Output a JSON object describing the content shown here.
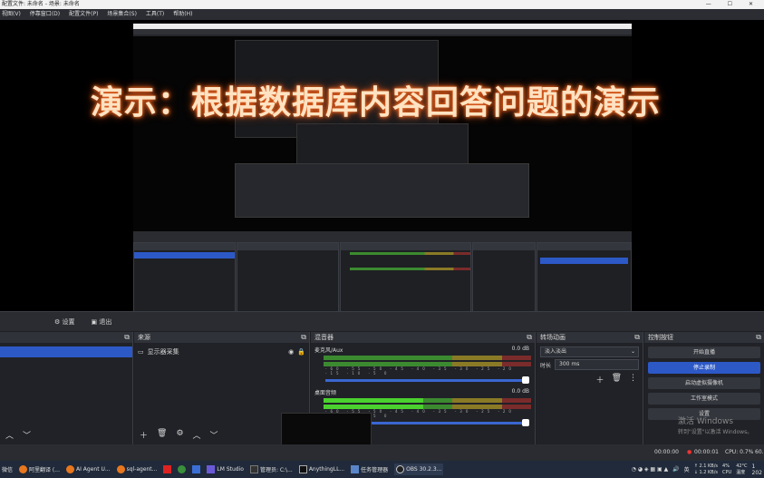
{
  "window": {
    "title": "配置文件: 未命名 - 场景: 未命名",
    "controls": "— ☐ ✕"
  },
  "menu": [
    "视图(V)",
    "停靠窗口(D)",
    "配置文件(P)",
    "场景集合(S)",
    "工具(T)",
    "帮助(H)"
  ],
  "overlay_text": "演示：根据数据库内容回答问题的演示",
  "tabs": {
    "settings": "设置",
    "exit": "退出"
  },
  "sources": {
    "title": "来源",
    "items": [
      {
        "label": "显示器采集"
      }
    ]
  },
  "mixer": {
    "title": "混音器",
    "channels": [
      {
        "name": "麦克风/Aux",
        "db": "0.0 dB"
      },
      {
        "name": "桌面音频",
        "db": "0.0 dB"
      }
    ],
    "scale": "-60 -55 -50 -45 -40 -35 -30 -25 -20 -15 -10 -5 0"
  },
  "transitions": {
    "title": "转场动画",
    "type": "淡入淡出",
    "duration_label": "时长",
    "duration_value": "300 ms"
  },
  "controls": {
    "title": "控制按钮",
    "buttons": [
      "开始直播",
      "停止录制",
      "启动虚拟摄像机",
      "工作室模式",
      "设置"
    ]
  },
  "watermark": {
    "line1": "激活 Windows",
    "line2": "转到\"设置\"以激活 Windows。"
  },
  "status": {
    "time1": "00:00:00",
    "time2": "00:00:01",
    "cpu": "CPU: 0.7%",
    "fps": "60."
  },
  "taskbar": {
    "items": [
      "微信",
      "阿里翻译 (...",
      "AI Agent U...",
      "sql-agent...",
      "LM Studio",
      "管理员: C:\\...",
      "AnythingLL...",
      "任务管理器",
      "OBS 30.2.3..."
    ],
    "net_up": "↑ 2.1 KB/s",
    "net_down": "↓ 1.2 KB/s",
    "cpu_pct": "4%\nCPU",
    "temp": "42°C\n温度",
    "lang": "英",
    "time": "1",
    "year": "202"
  },
  "colors": {
    "accent": "#2d59c7",
    "overlay_glow": "#d9531e",
    "meter_green": "#4bd12f"
  }
}
